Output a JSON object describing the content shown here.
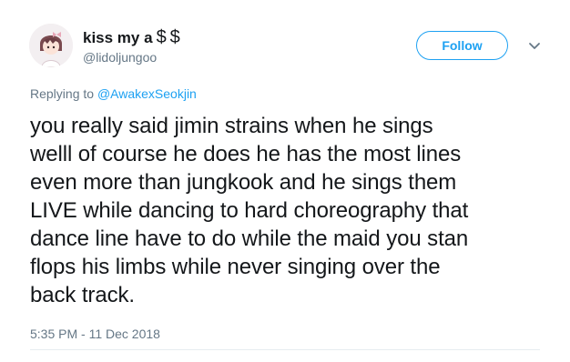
{
  "author": {
    "display_name": "kiss my a",
    "display_name_emoji": "$$",
    "handle": "@lidoljungoo",
    "avatar_icon": "anime-avatar-icon"
  },
  "actions": {
    "follow_label": "Follow",
    "more_icon": "chevron-down-icon"
  },
  "reply": {
    "prefix": "Replying to ",
    "mention": "@AwakexSeokjin"
  },
  "tweet": {
    "text": "you really said jimin strains when he sings\nwelll of course he does he has the most lines\neven more than jungkook and he sings them\nLIVE while dancing to hard choreography that\ndance line have to do while the maid you stan\nflops his limbs while never singing over the\nback track.",
    "timestamp": "5:35 PM - 11 Dec 2018"
  },
  "colors": {
    "accent": "#1da1f2",
    "secondary_text": "#657786",
    "primary_text": "#14171a",
    "divider": "#e6ecf0"
  }
}
